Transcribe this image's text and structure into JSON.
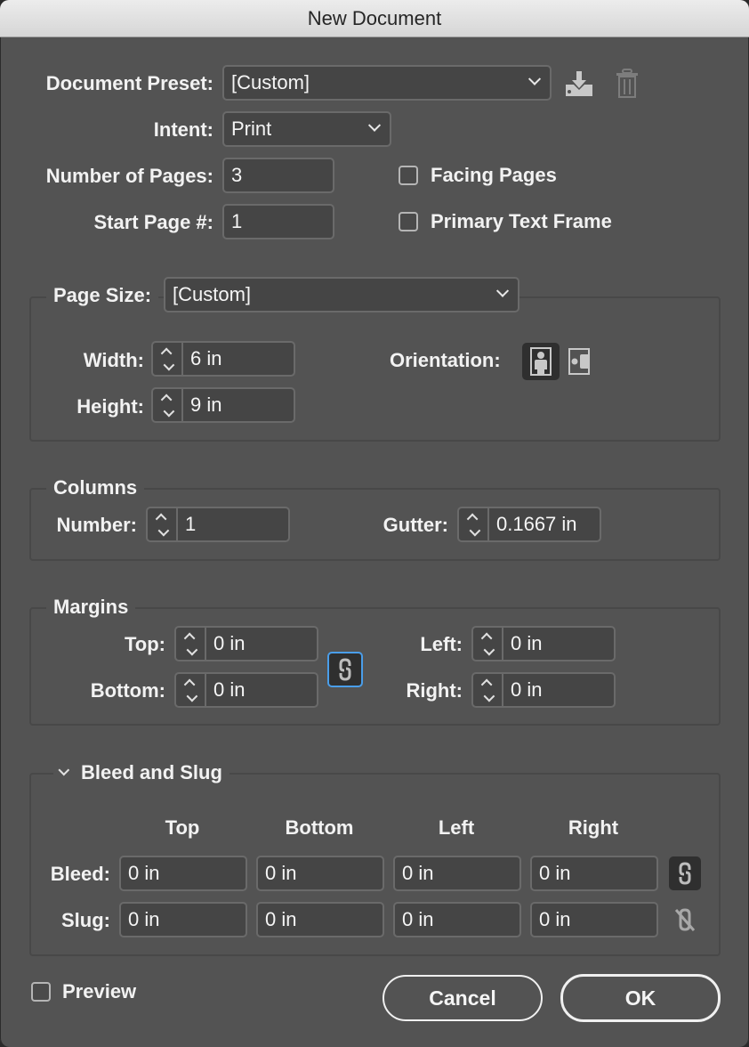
{
  "window": {
    "title": "New Document"
  },
  "preset": {
    "label": "Document Preset:",
    "value": "[Custom]",
    "save_icon": "save-preset-icon",
    "delete_icon": "trash-icon"
  },
  "intent": {
    "label": "Intent:",
    "value": "Print"
  },
  "pages": {
    "number_label": "Number of Pages:",
    "number_value": "3",
    "start_label": "Start Page #:",
    "start_value": "1",
    "facing_label": "Facing Pages",
    "facing_checked": false,
    "primary_label": "Primary Text Frame",
    "primary_checked": false
  },
  "page_size": {
    "label": "Page Size:",
    "value": "[Custom]",
    "width_label": "Width:",
    "width_value": "6 in",
    "height_label": "Height:",
    "height_value": "9 in",
    "orientation_label": "Orientation:",
    "orientation_selected": "portrait"
  },
  "columns": {
    "title": "Columns",
    "number_label": "Number:",
    "number_value": "1",
    "gutter_label": "Gutter:",
    "gutter_value": "0.1667 in"
  },
  "margins": {
    "title": "Margins",
    "top_label": "Top:",
    "top_value": "0 in",
    "bottom_label": "Bottom:",
    "bottom_value": "0 in",
    "left_label": "Left:",
    "left_value": "0 in",
    "right_label": "Right:",
    "right_value": "0 in",
    "linked": true
  },
  "bleed_slug": {
    "title": "Bleed and Slug",
    "expanded": true,
    "columns": [
      "Top",
      "Bottom",
      "Left",
      "Right"
    ],
    "bleed_label": "Bleed:",
    "bleed_values": [
      "0 in",
      "0 in",
      "0 in",
      "0 in"
    ],
    "bleed_linked": true,
    "slug_label": "Slug:",
    "slug_values": [
      "0 in",
      "0 in",
      "0 in",
      "0 in"
    ],
    "slug_linked": false
  },
  "footer": {
    "preview_label": "Preview",
    "preview_checked": false,
    "cancel_label": "Cancel",
    "ok_label": "OK"
  },
  "colors": {
    "accent": "#4a9eea",
    "background": "#535353",
    "field": "#454545"
  }
}
